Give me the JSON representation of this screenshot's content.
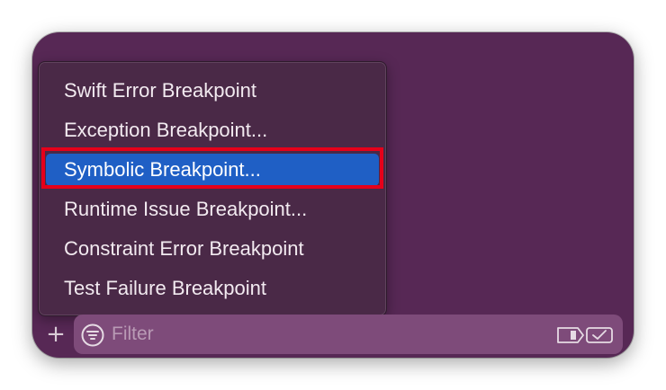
{
  "menu": {
    "items": [
      {
        "label": "Swift Error Breakpoint",
        "selected": false
      },
      {
        "label": "Exception Breakpoint...",
        "selected": false
      },
      {
        "label": "Symbolic Breakpoint...",
        "selected": true
      },
      {
        "label": "Runtime Issue Breakpoint...",
        "selected": false
      },
      {
        "label": "Constraint Error Breakpoint",
        "selected": false
      },
      {
        "label": "Test Failure Breakpoint",
        "selected": false
      }
    ]
  },
  "toolbar": {
    "add_icon": "plus-icon",
    "filter_placeholder": "Filter",
    "filter_icon": "filter-icon",
    "toggle_icons": [
      "breakpoint-icon",
      "checkmark-icon"
    ]
  },
  "colors": {
    "background": "#572855",
    "menu_background": "#4a2947",
    "selection": "#1f5fc5",
    "annotation_outline": "#e6001a",
    "filter_bar": "#7e4b7a"
  }
}
